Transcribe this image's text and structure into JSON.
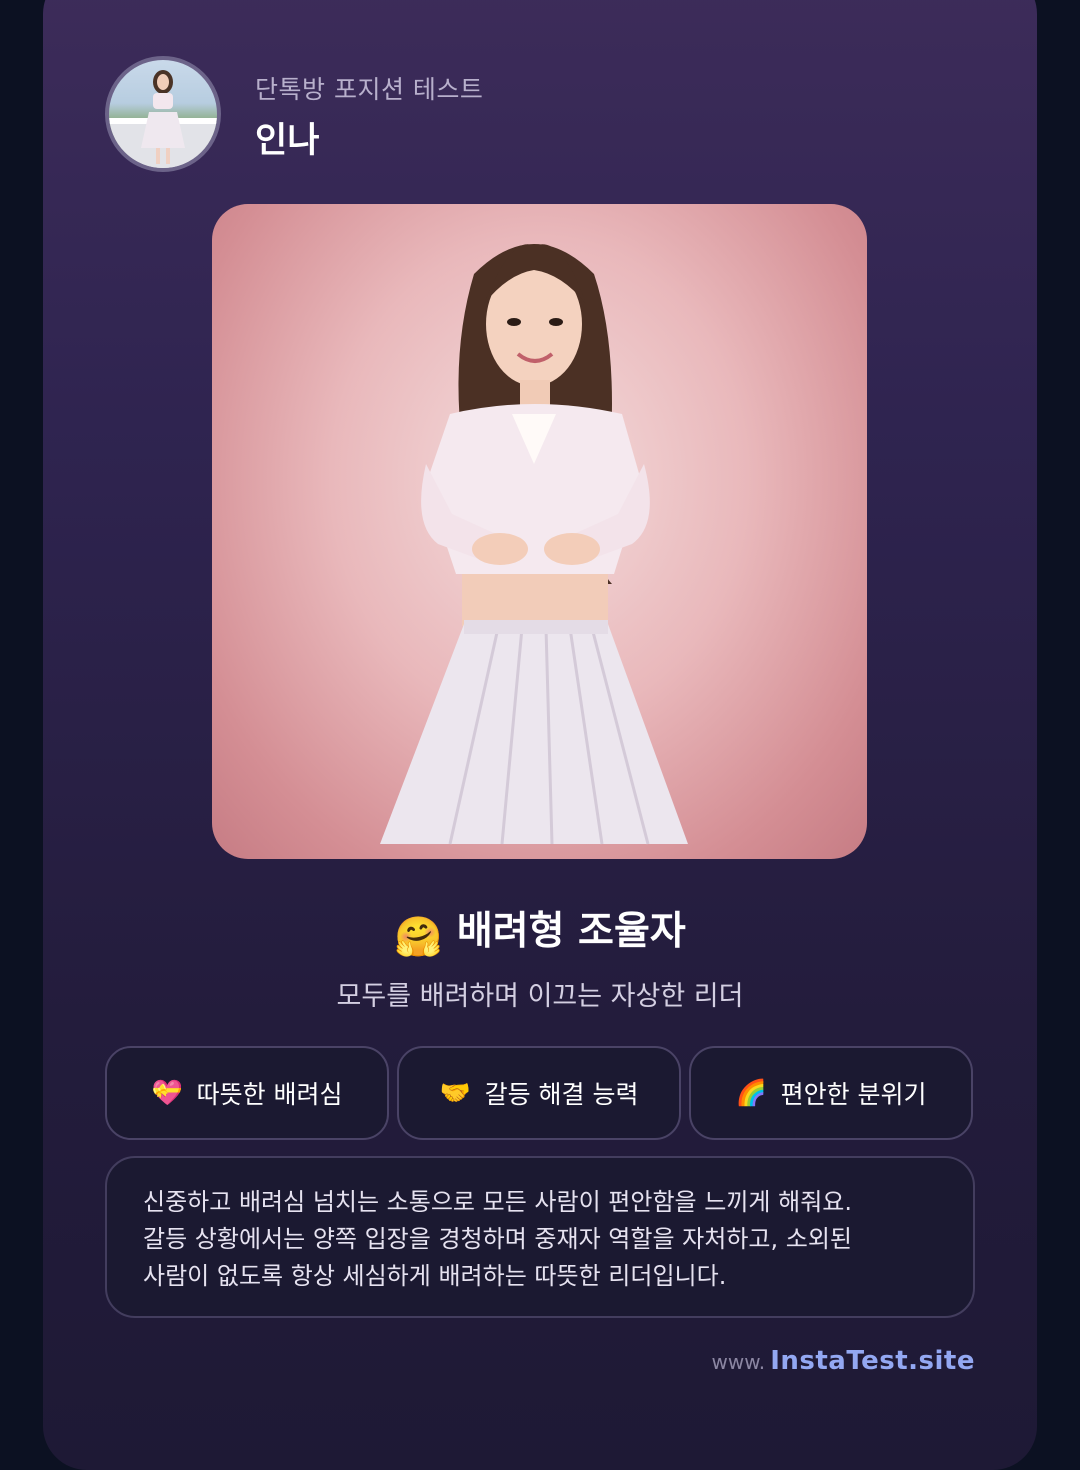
{
  "header": {
    "subtitle": "단톡방 포지션 테스트",
    "name": "인나"
  },
  "result": {
    "emoji": "🤗",
    "title": "배려형 조율자",
    "subtitle": "모두를 배려하며 이끄는 자상한 리더"
  },
  "traits": [
    {
      "icon": "💝",
      "icon_name": "heart-gift-icon",
      "label": "따뜻한 배려심"
    },
    {
      "icon": "🤝",
      "icon_name": "handshake-icon",
      "label": "갈등 해결 능력"
    },
    {
      "icon": "🌈",
      "icon_name": "rainbow-icon",
      "label": "편안한 분위기"
    }
  ],
  "description": {
    "line1": "신중하고 배려심 넘치는 소통으로 모든 사람이 편안함을 느끼게 해줘요.",
    "line2": "갈등 상황에서는 양쪽 입장을 경청하며 중재자 역할을 자처하고, 소외된",
    "line3": "사람이 없도록 항상 세심하게 배려하는 따뜻한 리더입니다."
  },
  "footer": {
    "prefix": "www.",
    "site": "InstaTest.site"
  },
  "colors": {
    "background": "#0c1122",
    "card_top": "#3d2c5a",
    "card_bottom": "#1e1935",
    "photo_bg": "#e9b8bb",
    "link": "#93a8f2"
  }
}
